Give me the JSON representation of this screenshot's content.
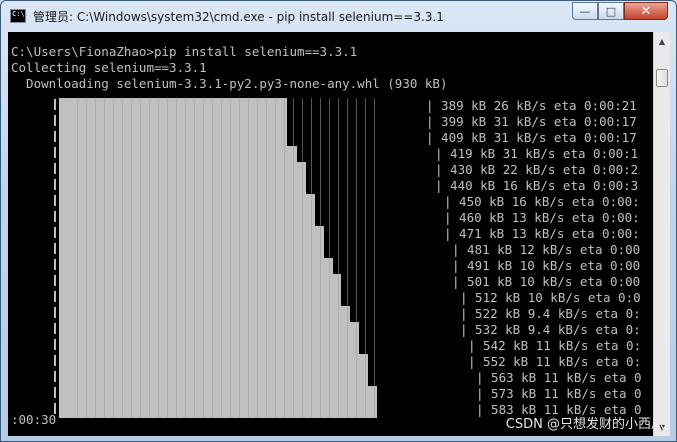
{
  "window": {
    "title": "管理员: C:\\Windows\\system32\\cmd.exe - pip  install selenium==3.3.1",
    "icon_text": "C:\\.",
    "buttons": {
      "minimize": "—",
      "maximize": "□",
      "close": "✕"
    }
  },
  "console": {
    "lines": [
      "C:\\Users\\FionaZhao>pip install selenium==3.3.1",
      "Collecting selenium==3.3.1",
      "  Downloading selenium-3.3.1-py2.py3-none-any.whl (930 kB)"
    ],
    "progress_stats": [
      "| 389 kB 26 kB/s eta 0:00:21",
      "| 399 kB 31 kB/s eta 0:00:17",
      "| 409 kB 31 kB/s eta 0:00:17",
      "| 419 kB 31 kB/s eta 0:00:1",
      "| 430 kB 22 kB/s eta 0:00:2",
      "| 440 kB 16 kB/s eta 0:00:3",
      "| 450 kB 16 kB/s eta 0:00:",
      "| 460 kB 13 kB/s eta 0:00:",
      "| 471 kB 13 kB/s eta 0:00:",
      "| 481 kB 12 kB/s eta 0:00",
      "| 491 kB 10 kB/s eta 0:00",
      "| 501 kB 10 kB/s eta 0:00",
      "| 512 kB 10 kB/s eta 0:0",
      "| 522 kB 9.4 kB/s eta 0:",
      "| 532 kB 9.4 kB/s eta 0:",
      "| 542 kB 11 kB/s eta 0:",
      "| 552 kB 11 kB/s eta 0:",
      "| 563 kB 11 kB/s eta 0",
      "| 573 kB 11 kB/s eta 0",
      "| 583 kB 11 kB/s eta 0"
    ],
    "last_line": ":00:30"
  },
  "watermark": "CSDN @只想发财的小西瓜"
}
